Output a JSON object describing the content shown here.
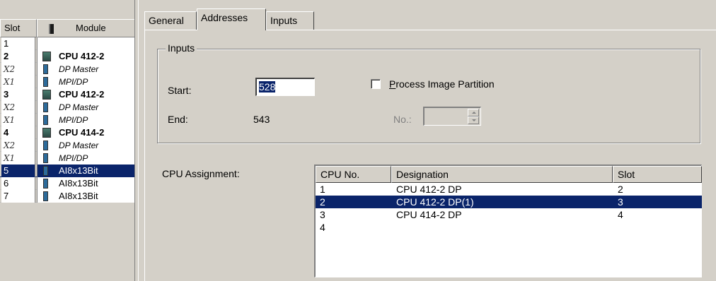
{
  "slot_table": {
    "headers": {
      "slot": "Slot",
      "module": "Module"
    },
    "rows": [
      {
        "slot": "1",
        "module": "",
        "kind": "empty"
      },
      {
        "slot": "2",
        "module": "CPU 412-2",
        "kind": "cpu"
      },
      {
        "slot": "X2",
        "module": "DP Master",
        "kind": "iface"
      },
      {
        "slot": "X1",
        "module": "MPI/DP",
        "kind": "iface"
      },
      {
        "slot": "3",
        "module": "CPU 412-2",
        "kind": "cpu"
      },
      {
        "slot": "X2",
        "module": "DP Master",
        "kind": "iface"
      },
      {
        "slot": "X1",
        "module": "MPI/DP",
        "kind": "iface"
      },
      {
        "slot": "4",
        "module": "CPU 414-2",
        "kind": "cpu"
      },
      {
        "slot": "X2",
        "module": "DP Master",
        "kind": "iface"
      },
      {
        "slot": "X1",
        "module": "MPI/DP",
        "kind": "iface"
      },
      {
        "slot": "5",
        "module": "AI8x13Bit",
        "kind": "module",
        "selected": true
      },
      {
        "slot": "6",
        "module": "AI8x13Bit",
        "kind": "module"
      },
      {
        "slot": "7",
        "module": "AI8x13Bit",
        "kind": "module"
      }
    ]
  },
  "tabs": [
    {
      "label": "General",
      "active": false
    },
    {
      "label": "Addresses",
      "active": true
    },
    {
      "label": "Inputs",
      "active": false
    }
  ],
  "inputs_group": {
    "legend": "Inputs",
    "start_label": "Start:",
    "start_value": "528",
    "end_label": "End:",
    "end_value": "543",
    "process_image_partition_label": "Process Image Partition",
    "process_image_partition_checked": false,
    "no_label": "No.:",
    "no_value": ""
  },
  "cpu_assignment": {
    "label": "CPU Assignment:",
    "columns": [
      "CPU No.",
      "Designation",
      "Slot"
    ],
    "rows": [
      {
        "cpu_no": "1",
        "designation": "CPU 412-2 DP",
        "slot": "2"
      },
      {
        "cpu_no": "2",
        "designation": "CPU 412-2 DP(1)",
        "slot": "3",
        "selected": true
      },
      {
        "cpu_no": "3",
        "designation": "CPU 414-2 DP",
        "slot": "4"
      },
      {
        "cpu_no": "4",
        "designation": "",
        "slot": ""
      }
    ]
  },
  "colors": {
    "dialog_bg": "#d4d0c8",
    "selection_bg": "#0a246a",
    "selection_text": "#ffffff"
  }
}
